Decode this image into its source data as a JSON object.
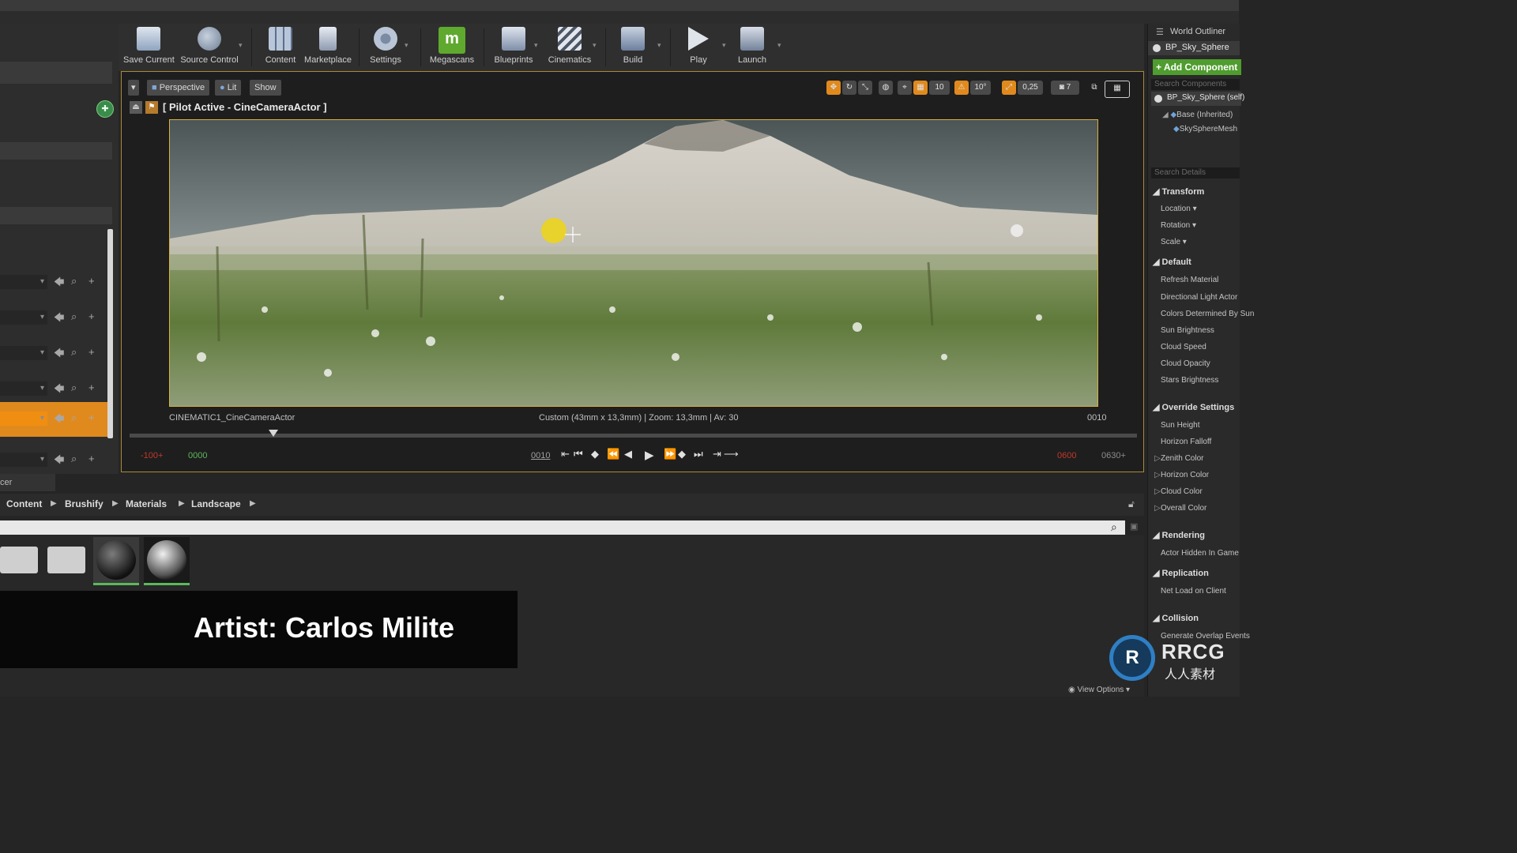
{
  "toolbar": {
    "buttons": [
      {
        "label": "Save Current",
        "icon": "save-icon"
      },
      {
        "label": "Source Control",
        "icon": "source-control-icon"
      },
      {
        "label": "Content",
        "icon": "content-icon"
      },
      {
        "label": "Marketplace",
        "icon": "marketplace-icon"
      },
      {
        "label": "Settings",
        "icon": "settings-icon"
      },
      {
        "label": "Megascans",
        "icon": "megascans-icon"
      },
      {
        "label": "Blueprints",
        "icon": "blueprints-icon"
      },
      {
        "label": "Cinematics",
        "icon": "cinematics-icon"
      },
      {
        "label": "Build",
        "icon": "build-icon"
      },
      {
        "label": "Play",
        "icon": "play-icon"
      },
      {
        "label": "Launch",
        "icon": "launch-icon"
      }
    ]
  },
  "viewport": {
    "perspective_label": "Perspective",
    "lit_label": "Lit",
    "show_label": "Show",
    "pilot_label": "[ Pilot Active - CineCameraActor ]",
    "grid_snap": "10",
    "rotation_snap": "10°",
    "scale_snap": "0,25",
    "camera_speed": "7",
    "camera_name": "CINEMATIC1_CineCameraActor",
    "camera_info": "Custom (43mm x 13,3mm) | Zoom: 13,3mm | Av: 30",
    "current_frame_right": "0010",
    "range_start": "-100+",
    "start_frame": "0000",
    "current_frame": "0010",
    "end_frame": "0600",
    "range_end": "0630+"
  },
  "content_browser": {
    "tab_label": "cer",
    "breadcrumb": [
      "Content",
      "Brushify",
      "Materials",
      "Landscape"
    ]
  },
  "overlay": {
    "artist": "Artist: Carlos Milite"
  },
  "right_panel": {
    "outliner_title": "World Outliner",
    "selected_actor": "BP_Sky_Sphere",
    "add_component": "+ Add Component",
    "search_components": "Search Components",
    "component_root": "BP_Sky_Sphere (self)",
    "component_base": "Base (Inherited)",
    "component_mesh": "SkySphereMesh",
    "search_details": "Search Details",
    "sections": {
      "transform": "Transform",
      "default": "Default",
      "override": "Override Settings",
      "rendering": "Rendering",
      "replication": "Replication",
      "collision": "Collision"
    },
    "transform_items": [
      "Location",
      "Rotation",
      "Scale"
    ],
    "default_items": [
      "Refresh Material",
      "Directional Light Actor",
      "Colors Determined By Sun",
      "Sun Brightness",
      "Cloud Speed",
      "Cloud Opacity",
      "Stars Brightness"
    ],
    "override_items": [
      "Sun Height",
      "Horizon Falloff",
      "Zenith Color",
      "Horizon Color",
      "Cloud Color",
      "Overall Color"
    ],
    "rendering_items": [
      "Actor Hidden In Game"
    ],
    "replication_items": [
      "Net Load on Client"
    ],
    "collision_items": [
      "Generate Overlap Events"
    ],
    "view_options": "View Options"
  },
  "watermark": {
    "text": "RRCG",
    "subtext": "人人素材"
  },
  "colors": {
    "accent_orange": "#e08a1e",
    "add_green": "#4f9c2f",
    "viewport_border": "#d9b040",
    "end_frame_red": "#c0392b",
    "start_frame_green": "#5cb85c"
  }
}
